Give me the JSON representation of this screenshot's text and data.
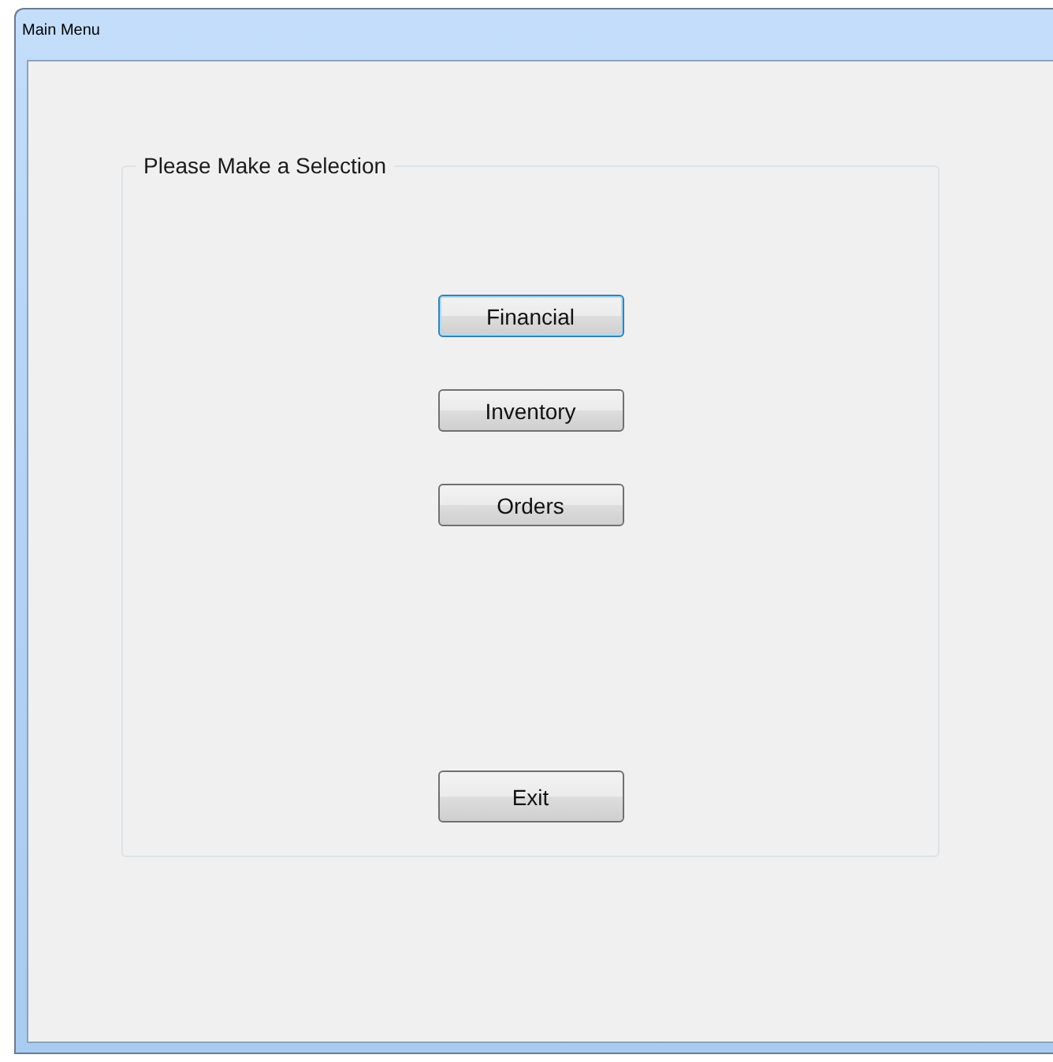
{
  "window": {
    "title": "Main Menu"
  },
  "group": {
    "title": "Please Make a Selection",
    "buttons": [
      {
        "label": "Financial",
        "focused": true
      },
      {
        "label": "Inventory",
        "focused": false
      },
      {
        "label": "Orders",
        "focused": false
      }
    ],
    "exit_button": {
      "label": "Exit",
      "focused": false
    }
  }
}
